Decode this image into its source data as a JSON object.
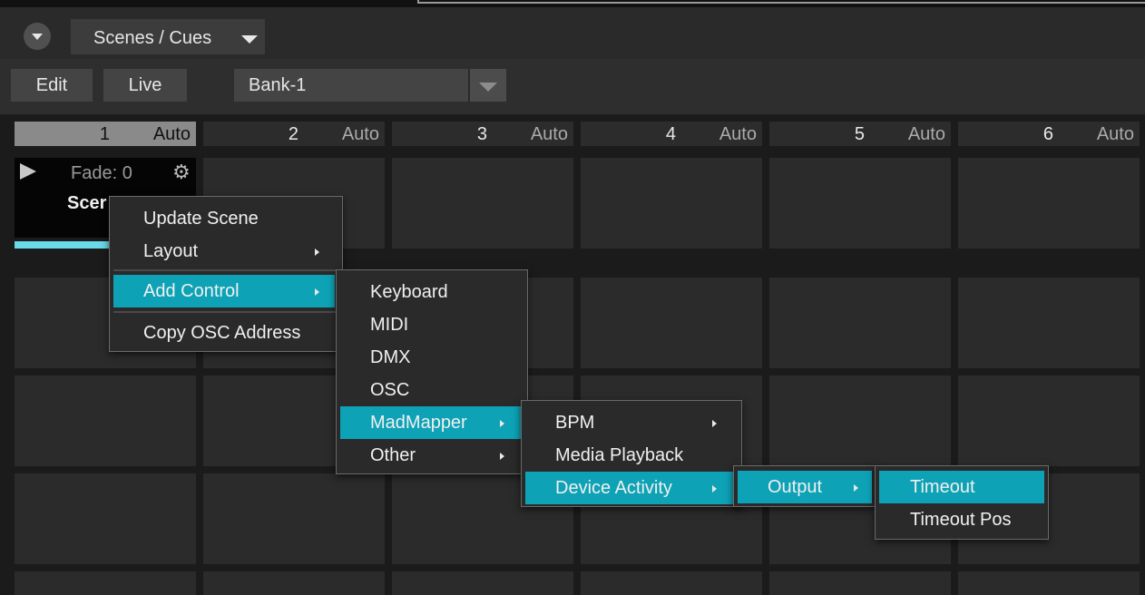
{
  "panel": {
    "title": "Scenes / Cues",
    "edit_label": "Edit",
    "live_label": "Live",
    "bank_value": "Bank-1"
  },
  "columns": [
    {
      "num": "1",
      "mode": "Auto",
      "active": true
    },
    {
      "num": "2",
      "mode": "Auto"
    },
    {
      "num": "3",
      "mode": "Auto"
    },
    {
      "num": "4",
      "mode": "Auto"
    },
    {
      "num": "5",
      "mode": "Auto"
    },
    {
      "num": "6",
      "mode": "Auto"
    }
  ],
  "scene": {
    "fade_text": "Fade: 0",
    "name_visible": "Scer",
    "progress": 1.0
  },
  "context_menu": {
    "items": [
      "Update Scene",
      "Layout",
      "Add Control",
      "Copy OSC Address"
    ],
    "highlighted": "Add Control"
  },
  "add_control_menu": {
    "items": [
      "Keyboard",
      "MIDI",
      "DMX",
      "OSC",
      "MadMapper",
      "Other"
    ],
    "highlighted": "MadMapper"
  },
  "madmapper_menu": {
    "items": [
      "BPM",
      "Media Playback",
      "Device Activity"
    ],
    "highlighted": "Device Activity"
  },
  "device_activity_menu": {
    "items": [
      "Output"
    ],
    "highlighted": "Output"
  },
  "output_menu": {
    "items": [
      "Timeout",
      "Timeout Pos"
    ],
    "highlighted": "Timeout"
  },
  "icons": {
    "collapse": "chevron-down-icon",
    "dropdown": "caret-down-icon",
    "play": "play-icon",
    "settings": "gear-icon",
    "submenu": "chevron-right-icon"
  },
  "colors": {
    "highlight": "#0ea2b6",
    "progress": "#6ad9e8",
    "background": "#1b1b1b"
  }
}
